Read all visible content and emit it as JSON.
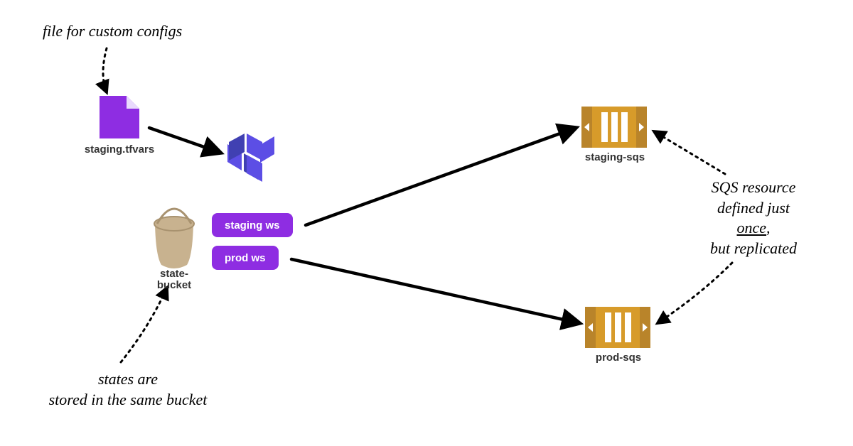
{
  "diagram": {
    "annotations": {
      "custom_configs": "file for custom configs",
      "states_bucket": "states are\nstored in the same bucket",
      "sqs_note": "SQS resource\ndefined just\nonce,\nbut replicated",
      "sqs_underline_word": "once"
    },
    "nodes": {
      "tfvars_file": {
        "label": "staging.tfvars"
      },
      "terraform_logo": {
        "label": ""
      },
      "bucket": {
        "label": "state-\nbucket"
      },
      "staging_ws": {
        "label": "staging ws"
      },
      "prod_ws": {
        "label": "prod ws"
      },
      "staging_sqs": {
        "label": "staging-sqs"
      },
      "prod_sqs": {
        "label": "prod-sqs"
      }
    },
    "colors": {
      "purple": "#8E2DE2",
      "terraform": "#5C4EE5",
      "bucket": "#C8B28F",
      "sqs_fill": "#D79B2A",
      "sqs_edge": "#B9842A"
    }
  }
}
